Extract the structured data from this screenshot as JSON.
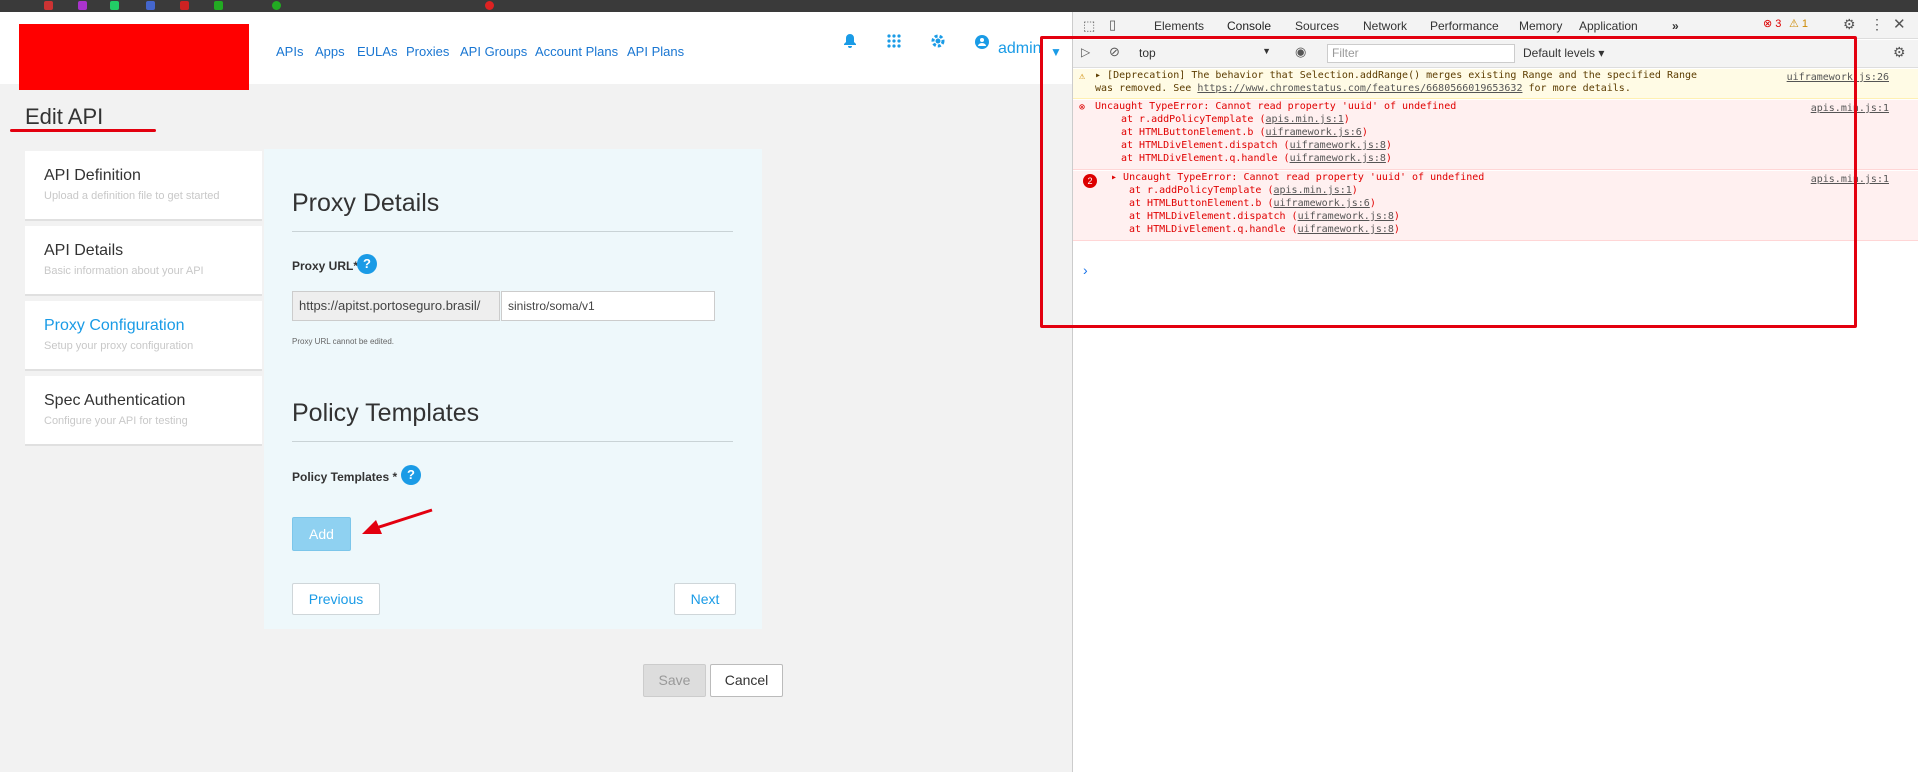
{
  "app": {
    "nav": [
      "APIs",
      "Apps",
      "EULAs",
      "Proxies",
      "API Groups",
      "Account Plans",
      "API Plans"
    ],
    "user": "admin",
    "page_title": "Edit API"
  },
  "steps": [
    {
      "title": "API Definition",
      "subtitle": "Upload a definition file to get started"
    },
    {
      "title": "API Details",
      "subtitle": "Basic information about your API"
    },
    {
      "title": "Proxy Configuration",
      "subtitle": "Setup your proxy configuration"
    },
    {
      "title": "Spec Authentication",
      "subtitle": "Configure your API for testing"
    }
  ],
  "proxy": {
    "heading": "Proxy Details",
    "url_label": "Proxy URL*",
    "url_prefix": "https://apitst.portoseguro.brasil/",
    "url_path": "sinistro/soma/v1",
    "note": "Proxy URL cannot be edited."
  },
  "policy": {
    "heading": "Policy Templates",
    "label": "Policy Templates *",
    "add_label": "Add"
  },
  "buttons": {
    "previous": "Previous",
    "next": "Next",
    "save": "Save",
    "cancel": "Cancel"
  },
  "devtools": {
    "tabs": [
      "Elements",
      "Console",
      "Sources",
      "Network",
      "Performance",
      "Memory",
      "Application"
    ],
    "error_count": "3",
    "warn_count": "1",
    "context": "top",
    "filter_placeholder": "Filter",
    "levels": "Default levels",
    "warning": {
      "line1": "[Deprecation] The behavior that Selection.addRange() merges existing Range and the specified Range",
      "line2_pre": "was removed. See ",
      "link": "https://www.chromestatus.com/features/6680566019653632",
      "line2_post": " for more details.",
      "src": "uiframework.js:26"
    },
    "errors": [
      {
        "message": "Uncaught TypeError: Cannot read property 'uuid' of undefined",
        "src": "apis.min.js:1",
        "stack": [
          {
            "pre": "at r.addPolicyTemplate (",
            "file": "apis.min.js:1",
            "post": ")"
          },
          {
            "pre": "at HTMLButtonElement.b (",
            "file": "uiframework.js:6",
            "post": ")"
          },
          {
            "pre": "at HTMLDivElement.dispatch (",
            "file": "uiframework.js:8",
            "post": ")"
          },
          {
            "pre": "at HTMLDivElement.q.handle (",
            "file": "uiframework.js:8",
            "post": ")"
          }
        ]
      },
      {
        "count": "2",
        "message": "Uncaught TypeError: Cannot read property 'uuid' of undefined",
        "src": "apis.min.js:1",
        "stack": [
          {
            "pre": "at r.addPolicyTemplate (",
            "file": "apis.min.js:1",
            "post": ")"
          },
          {
            "pre": "at HTMLButtonElement.b (",
            "file": "uiframework.js:6",
            "post": ")"
          },
          {
            "pre": "at HTMLDivElement.dispatch (",
            "file": "uiframework.js:8",
            "post": ")"
          },
          {
            "pre": "at HTMLDivElement.q.handle (",
            "file": "uiframework.js:8",
            "post": ")"
          }
        ]
      }
    ]
  },
  "colors": {
    "accent": "#1a9be6",
    "annotation": "#e3000f",
    "error": "#e00000"
  }
}
